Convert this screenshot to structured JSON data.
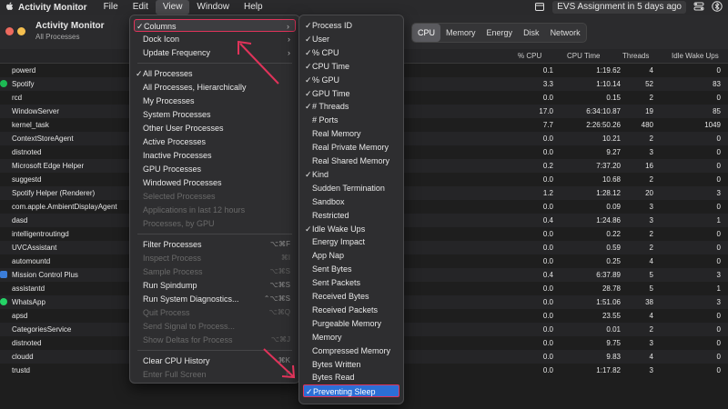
{
  "menubar": {
    "app_name": "Activity Monitor",
    "menus": [
      "File",
      "Edit",
      "View",
      "Window",
      "Help"
    ],
    "status": "EVS Assignment in 5 days ago",
    "icons": [
      "apple-icon",
      "calendar-icon",
      "control-center-icon",
      "bluetooth-icon"
    ]
  },
  "window": {
    "title": "Activity Monitor",
    "subtitle": "All Processes",
    "tabs": [
      "CPU",
      "Memory",
      "Energy",
      "Disk",
      "Network"
    ],
    "selected_tab": "CPU"
  },
  "columns": {
    "cpu": "% CPU",
    "cpu_time": "CPU Time",
    "threads": "Threads",
    "idle_wake_ups": "Idle Wake Ups"
  },
  "processes": [
    {
      "name": "powerd",
      "cpu": "0.1",
      "time": "1:19.62",
      "threads": "4",
      "idle": "0"
    },
    {
      "name": "Spotify",
      "cpu": "3.3",
      "time": "1:10.14",
      "threads": "52",
      "idle": "83"
    },
    {
      "name": "rcd",
      "cpu": "0.0",
      "time": "0.15",
      "threads": "2",
      "idle": "0"
    },
    {
      "name": "WindowServer",
      "cpu": "17.0",
      "time": "6:34:10.87",
      "threads": "19",
      "idle": "85"
    },
    {
      "name": "kernel_task",
      "cpu": "7.7",
      "time": "2:26:50.26",
      "threads": "480",
      "idle": "1049"
    },
    {
      "name": "ContextStoreAgent",
      "cpu": "0.0",
      "time": "10.21",
      "threads": "2",
      "idle": "0"
    },
    {
      "name": "distnoted",
      "cpu": "0.0",
      "time": "9.27",
      "threads": "3",
      "idle": "0"
    },
    {
      "name": "Microsoft Edge Helper",
      "cpu": "0.2",
      "time": "7:37.20",
      "threads": "16",
      "idle": "0"
    },
    {
      "name": "suggestd",
      "cpu": "0.0",
      "time": "10.68",
      "threads": "2",
      "idle": "0"
    },
    {
      "name": "Spotify Helper (Renderer)",
      "cpu": "1.2",
      "time": "1:28.12",
      "threads": "20",
      "idle": "3"
    },
    {
      "name": "com.apple.AmbientDisplayAgent",
      "cpu": "0.0",
      "time": "0.09",
      "threads": "3",
      "idle": "0"
    },
    {
      "name": "dasd",
      "cpu": "0.4",
      "time": "1:24.86",
      "threads": "3",
      "idle": "1"
    },
    {
      "name": "intelligentroutingd",
      "cpu": "0.0",
      "time": "0.22",
      "threads": "2",
      "idle": "0"
    },
    {
      "name": "UVCAssistant",
      "cpu": "0.0",
      "time": "0.59",
      "threads": "2",
      "idle": "0"
    },
    {
      "name": "automountd",
      "cpu": "0.0",
      "time": "0.25",
      "threads": "4",
      "idle": "0"
    },
    {
      "name": "Mission Control Plus",
      "cpu": "0.4",
      "time": "6:37.89",
      "threads": "5",
      "idle": "3"
    },
    {
      "name": "assistantd",
      "cpu": "0.0",
      "time": "28.78",
      "threads": "5",
      "idle": "1"
    },
    {
      "name": "WhatsApp",
      "cpu": "0.0",
      "time": "1:51.06",
      "threads": "38",
      "idle": "3"
    },
    {
      "name": "apsd",
      "cpu": "0.0",
      "time": "23.55",
      "threads": "4",
      "idle": "0"
    },
    {
      "name": "CategoriesService",
      "cpu": "0.0",
      "time": "0.01",
      "threads": "2",
      "idle": "0"
    },
    {
      "name": "distnoted",
      "cpu": "0.0",
      "time": "9.75",
      "threads": "3",
      "idle": "0"
    },
    {
      "name": "cloudd",
      "cpu": "0.0",
      "time": "9.83",
      "threads": "4",
      "idle": "0"
    },
    {
      "name": "trustd",
      "cpu": "0.0",
      "time": "1:17.82",
      "threads": "3",
      "idle": "0"
    }
  ],
  "view_menu": {
    "items": [
      {
        "label": "Columns",
        "check": true,
        "submenu": true,
        "highlight": true
      },
      {
        "label": "Dock Icon",
        "submenu": true
      },
      {
        "label": "Update Frequency",
        "submenu": true
      },
      {
        "sep": true
      },
      {
        "label": "All Processes",
        "check": true
      },
      {
        "label": "All Processes, Hierarchically"
      },
      {
        "label": "My Processes"
      },
      {
        "label": "System Processes"
      },
      {
        "label": "Other User Processes"
      },
      {
        "label": "Active Processes"
      },
      {
        "label": "Inactive Processes"
      },
      {
        "label": "GPU Processes"
      },
      {
        "label": "Windowed Processes"
      },
      {
        "label": "Selected Processes",
        "disabled": true
      },
      {
        "label": "Applications in last 12 hours",
        "disabled": true
      },
      {
        "label": "Processes, by GPU",
        "disabled": true
      },
      {
        "sep": true
      },
      {
        "label": "Filter Processes",
        "shortcut": "⌥⌘F"
      },
      {
        "label": "Inspect Process",
        "shortcut": "⌘I",
        "disabled": true
      },
      {
        "label": "Sample Process",
        "shortcut": "⌥⌘S",
        "disabled": true
      },
      {
        "label": "Run Spindump",
        "shortcut": "⌥⌘S"
      },
      {
        "label": "Run System Diagnostics...",
        "shortcut": "⌃⌥⌘S"
      },
      {
        "label": "Quit Process",
        "shortcut": "⌥⌘Q",
        "disabled": true
      },
      {
        "label": "Send Signal to Process...",
        "disabled": true
      },
      {
        "label": "Show Deltas for Process",
        "shortcut": "⌥⌘J",
        "disabled": true
      },
      {
        "sep": true
      },
      {
        "label": "Clear CPU History",
        "shortcut": "⌘K"
      },
      {
        "label": "Enter Full Screen",
        "shortcut": "F",
        "disabled": true
      }
    ]
  },
  "columns_submenu": {
    "items": [
      {
        "label": "Process ID",
        "check": true
      },
      {
        "label": "User",
        "check": true
      },
      {
        "label": "% CPU",
        "check": true
      },
      {
        "label": "CPU Time",
        "check": true
      },
      {
        "label": "% GPU",
        "check": true
      },
      {
        "label": "GPU Time",
        "check": true
      },
      {
        "label": "# Threads",
        "check": true
      },
      {
        "label": "# Ports"
      },
      {
        "label": "Real Memory"
      },
      {
        "label": "Real Private Memory"
      },
      {
        "label": "Real Shared Memory"
      },
      {
        "label": "Kind",
        "check": true
      },
      {
        "label": "Sudden Termination"
      },
      {
        "label": "Sandbox"
      },
      {
        "label": "Restricted"
      },
      {
        "label": "Idle Wake Ups",
        "check": true
      },
      {
        "label": "Energy Impact"
      },
      {
        "label": "App Nap"
      },
      {
        "label": "Sent Bytes"
      },
      {
        "label": "Sent Packets"
      },
      {
        "label": "Received Bytes"
      },
      {
        "label": "Received Packets"
      },
      {
        "label": "Purgeable Memory"
      },
      {
        "label": "Memory"
      },
      {
        "label": "Compressed Memory"
      },
      {
        "label": "Bytes Written"
      },
      {
        "label": "Bytes Read"
      },
      {
        "label": "Preventing Sleep",
        "check": true,
        "selected": true
      }
    ]
  },
  "colors": {
    "highlight_border": "#e0335a",
    "selection_blue": "#2c6fd6",
    "annotation_arrow": "#e0335a"
  }
}
